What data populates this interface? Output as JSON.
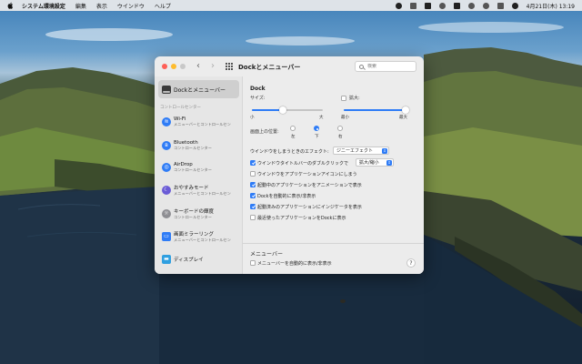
{
  "menubar": {
    "app_name": "システム環境設定",
    "items": [
      "編集",
      "表示",
      "ウインドウ",
      "ヘルプ"
    ],
    "clock": "4月21日(木) 13:19"
  },
  "window": {
    "title": "Dockとメニューバー",
    "search_placeholder": "検索"
  },
  "sidebar": {
    "selected": "Dockとメニューバー",
    "section": "コントロールセンター",
    "items": [
      {
        "name": "Wi-Fi",
        "sub": "メニューバーとコントロールセン",
        "color": "#2f7cf6",
        "glyph": "≋"
      },
      {
        "name": "Bluetooth",
        "sub": "コントロールセンター",
        "color": "#2f7cf6",
        "glyph": "ʙ"
      },
      {
        "name": "AirDrop",
        "sub": "コントロールセンター",
        "color": "#2f7cf6",
        "glyph": "◎"
      },
      {
        "name": "おやすみモード",
        "sub": "メニューバーとコントロールセン",
        "color": "#6a5bd6",
        "glyph": "☾"
      },
      {
        "name": "キーボードの輝度",
        "sub": "コントロールセンター",
        "color": "#8e8e93",
        "glyph": "☼"
      },
      {
        "name": "画面ミラーリング",
        "sub": "メニューバーとコントロールセン",
        "color": "#2f7cf6",
        "glyph": "▭"
      },
      {
        "name": "ディスプレイ",
        "sub": "",
        "color": "#2f9fe0",
        "glyph": "▬"
      }
    ]
  },
  "dock": {
    "section_title": "Dock",
    "size_label": "サイズ:",
    "size_small": "小",
    "size_large": "大",
    "size_value": 0.43,
    "magnify_label": "拡大:",
    "magnify_min": "最小",
    "magnify_max": "最大",
    "magnify_value": 1.0,
    "position_label": "画面上の位置:",
    "positions": [
      "左",
      "下",
      "右"
    ],
    "position_selected": "下",
    "minimize_effect_label": "ウインドウをしまうときのエフェクト:",
    "minimize_effect_value": "ジニーエフェクト",
    "options": [
      {
        "text": "ウインドウタイトルバーのダブルクリックで",
        "checked": true,
        "popup": "拡大/縮小"
      },
      {
        "text": "ウインドウをアプリケーションアイコンにしまう",
        "checked": false
      },
      {
        "text": "起動中のアプリケーションをアニメーションで表示",
        "checked": true
      },
      {
        "text": "Dockを自動的に表示/非表示",
        "checked": true
      },
      {
        "text": "起動済みのアプリケーションにインジケータを表示",
        "checked": true
      },
      {
        "text": "最近使ったアプリケーションをDockに表示",
        "checked": false
      }
    ]
  },
  "menubar_section": {
    "title": "メニューバー",
    "option": "メニューバーを自動的に表示/非表示",
    "checked": false,
    "help": "?"
  },
  "colors": {
    "accent": "#2f7cf6",
    "close": "#fe5f57",
    "minimize": "#febc2e"
  }
}
